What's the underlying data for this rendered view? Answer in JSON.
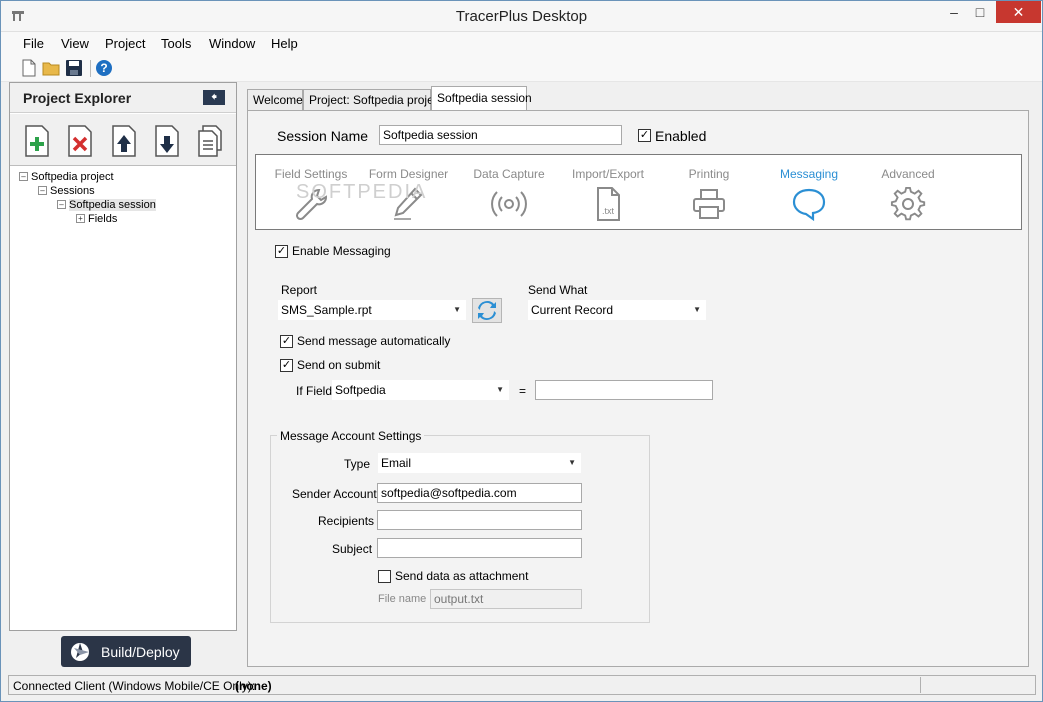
{
  "window": {
    "title": "TracerPlus Desktop"
  },
  "menu": [
    "File",
    "View",
    "Project",
    "Tools",
    "Window",
    "Help"
  ],
  "explorer": {
    "title": "Project Explorer",
    "tree": {
      "project": "Softpedia project",
      "sessions": "Sessions",
      "session": "Softpedia session",
      "fields": "Fields"
    },
    "build_label": "Build/Deploy"
  },
  "tabs": [
    "Welcome",
    "Project: Softpedia project",
    "Softpedia session"
  ],
  "session": {
    "name_label": "Session Name",
    "name_value": "Softpedia session",
    "enabled_label": "Enabled"
  },
  "nav": [
    "Field Settings",
    "Form Designer",
    "Data Capture",
    "Import/Export",
    "Printing",
    "Messaging",
    "Advanced"
  ],
  "nav_export_icon_text": ".txt",
  "watermark": "SOFTPEDIA",
  "messaging": {
    "enable_label": "Enable Messaging",
    "report_label": "Report",
    "report_value": "SMS_Sample.rpt",
    "send_what_label": "Send What",
    "send_what_value": "Current Record",
    "auto_label": "Send message automatically",
    "submit_label": "Send on submit",
    "iffield_label": "If Field",
    "iffield_value": "Softpedia",
    "equals": "=",
    "iffield_compare": ""
  },
  "account": {
    "group_title": "Message Account Settings",
    "type_label": "Type",
    "type_value": "Email",
    "sender_label": "Sender Account",
    "sender_value": "softpedia@softpedia.com",
    "recipients_label": "Recipients",
    "recipients_value": "",
    "subject_label": "Subject",
    "subject_value": "",
    "attach_label": "Send data as attachment",
    "filename_label": "File name",
    "filename_value": "output.txt"
  },
  "status": {
    "label": "Connected Client (Windows Mobile/CE Only):",
    "value": "(none)"
  },
  "colors": {
    "accent": "#2b8fd4",
    "dark_button": "#2b3547",
    "close_red": "#c7372f"
  }
}
